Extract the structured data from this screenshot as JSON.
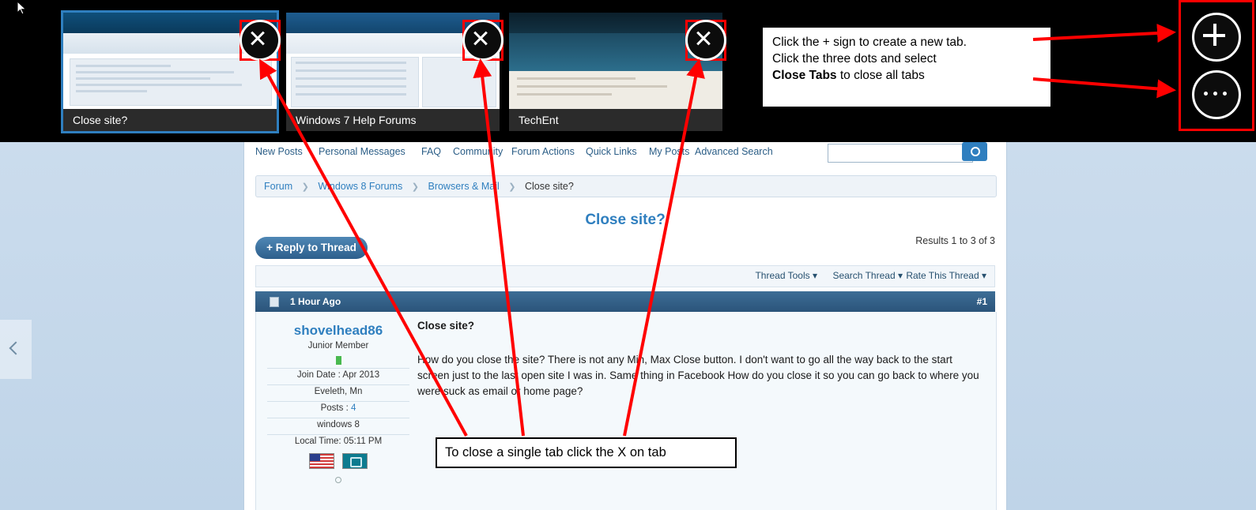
{
  "tabstrip": {
    "tabs": [
      {
        "label": "Close site?",
        "selected": true,
        "close_icon": "close-icon"
      },
      {
        "label": "Windows 7 Help Forums",
        "selected": false,
        "close_icon": "close-icon"
      },
      {
        "label": "TechEnt",
        "selected": false,
        "close_icon": "close-icon"
      }
    ],
    "buttons": [
      {
        "name": "new-tab-button",
        "icon": "plus-icon"
      },
      {
        "name": "more-options-button",
        "icon": "ellipsis-icon"
      }
    ]
  },
  "callouts": {
    "top": {
      "line1": "Click the + sign to create a new tab.",
      "line2": "Click the three dots and select",
      "line3_bold": "Close Tabs",
      "line3_rest": " to close all tabs"
    },
    "bottom": {
      "text": "To close a single tab click the X on tab"
    }
  },
  "forum": {
    "nav": [
      "New Posts",
      "Personal Messages",
      "FAQ",
      "Community",
      "Forum Actions",
      "Quick Links",
      "My Posts",
      "Advanced Search"
    ],
    "search": {
      "value": "",
      "placeholder": ""
    },
    "breadcrumb": [
      "Forum",
      "Windows 8 Forums",
      "Browsers & Mail",
      "Close site?"
    ],
    "thread_title": "Close site?",
    "results": "Results 1 to 3 of 3",
    "reply_button": "+ Reply to Thread",
    "tools": [
      "Thread Tools",
      "Search Thread",
      "Rate This Thread"
    ],
    "post": {
      "time": "1 Hour Ago",
      "number": "#1",
      "author": "shovelhead86",
      "author_title": "Junior Member",
      "join_date_label": "Join Date : Apr 2013",
      "location": "Eveleth, Mn",
      "posts_label": "Posts :",
      "posts_count": "4",
      "os": "windows 8",
      "local_time": "Local Time: 05:11 PM",
      "subject": "Close site?",
      "body": "How do you close the site? There is not any Min, Max Close button. I don't want to go all the way back to the start screen just to the last open site I was in. Same thing in Facebook How do you close it so you can go back to where you were suck as email or home page?"
    }
  },
  "colors": {
    "accent": "#2f7fbf",
    "annotation": "#ff0000",
    "tabstrip_bg": "#000000",
    "tab_label_bg": "#2b2b2b"
  }
}
